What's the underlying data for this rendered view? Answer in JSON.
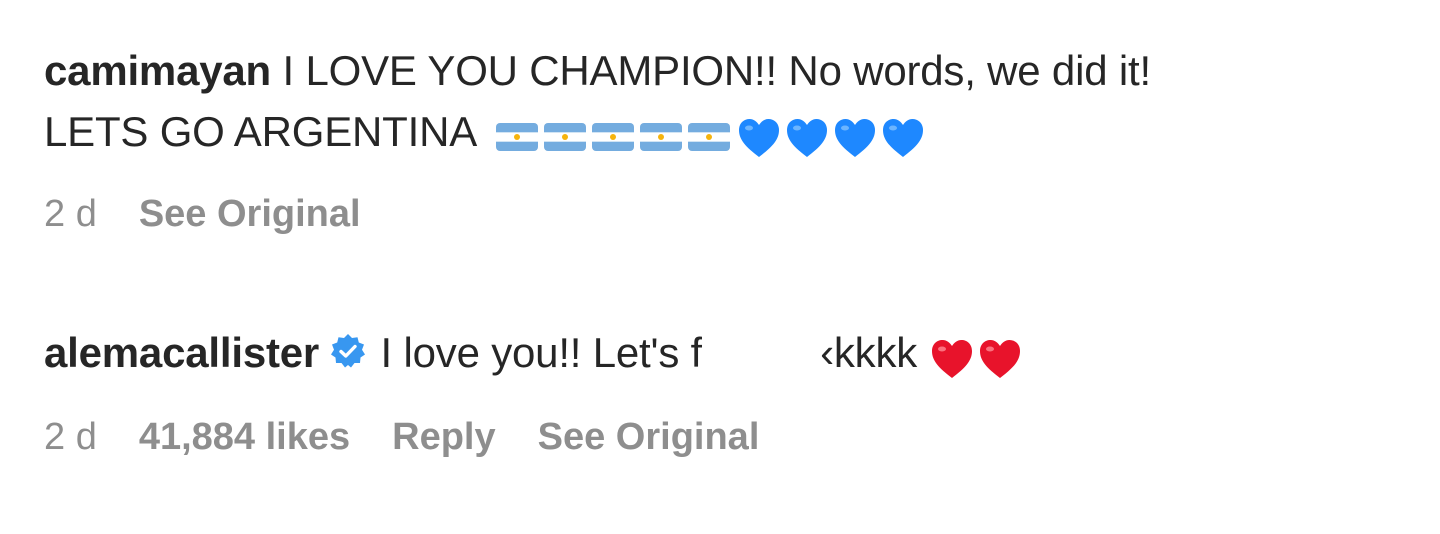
{
  "comments": [
    {
      "username": "camimayan",
      "text_line1": "I LOVE YOU CHAMPION!! No words, we did it!",
      "text_line2": "LETS GO ARGENTINA",
      "emoji": {
        "flags": [
          "flag-argentina-icon",
          "flag-argentina-icon",
          "flag-argentina-icon",
          "flag-argentina-icon",
          "flag-argentina-icon"
        ],
        "hearts": [
          "blue-heart-icon",
          "blue-heart-icon",
          "blue-heart-icon",
          "blue-heart-icon"
        ]
      },
      "time": "2 d",
      "see_original": "See Original"
    },
    {
      "username": "alemacallister",
      "verified": true,
      "text_before_redaction": "I love you!! Let's f",
      "text_after_redaction": "‹kkkk",
      "emoji": {
        "hearts": [
          "red-heart-icon",
          "red-heart-icon"
        ]
      },
      "time": "2 d",
      "likes": "41,884 likes",
      "reply": "Reply",
      "see_original": "See Original"
    }
  ],
  "colors": {
    "text": "#262626",
    "meta": "#8e8e8e",
    "verified": "#3897f0",
    "blue_heart": "#1e88ff",
    "red_heart": "#e8132b",
    "flag_blue": "#74acdf",
    "flag_sun": "#f6b40e"
  }
}
